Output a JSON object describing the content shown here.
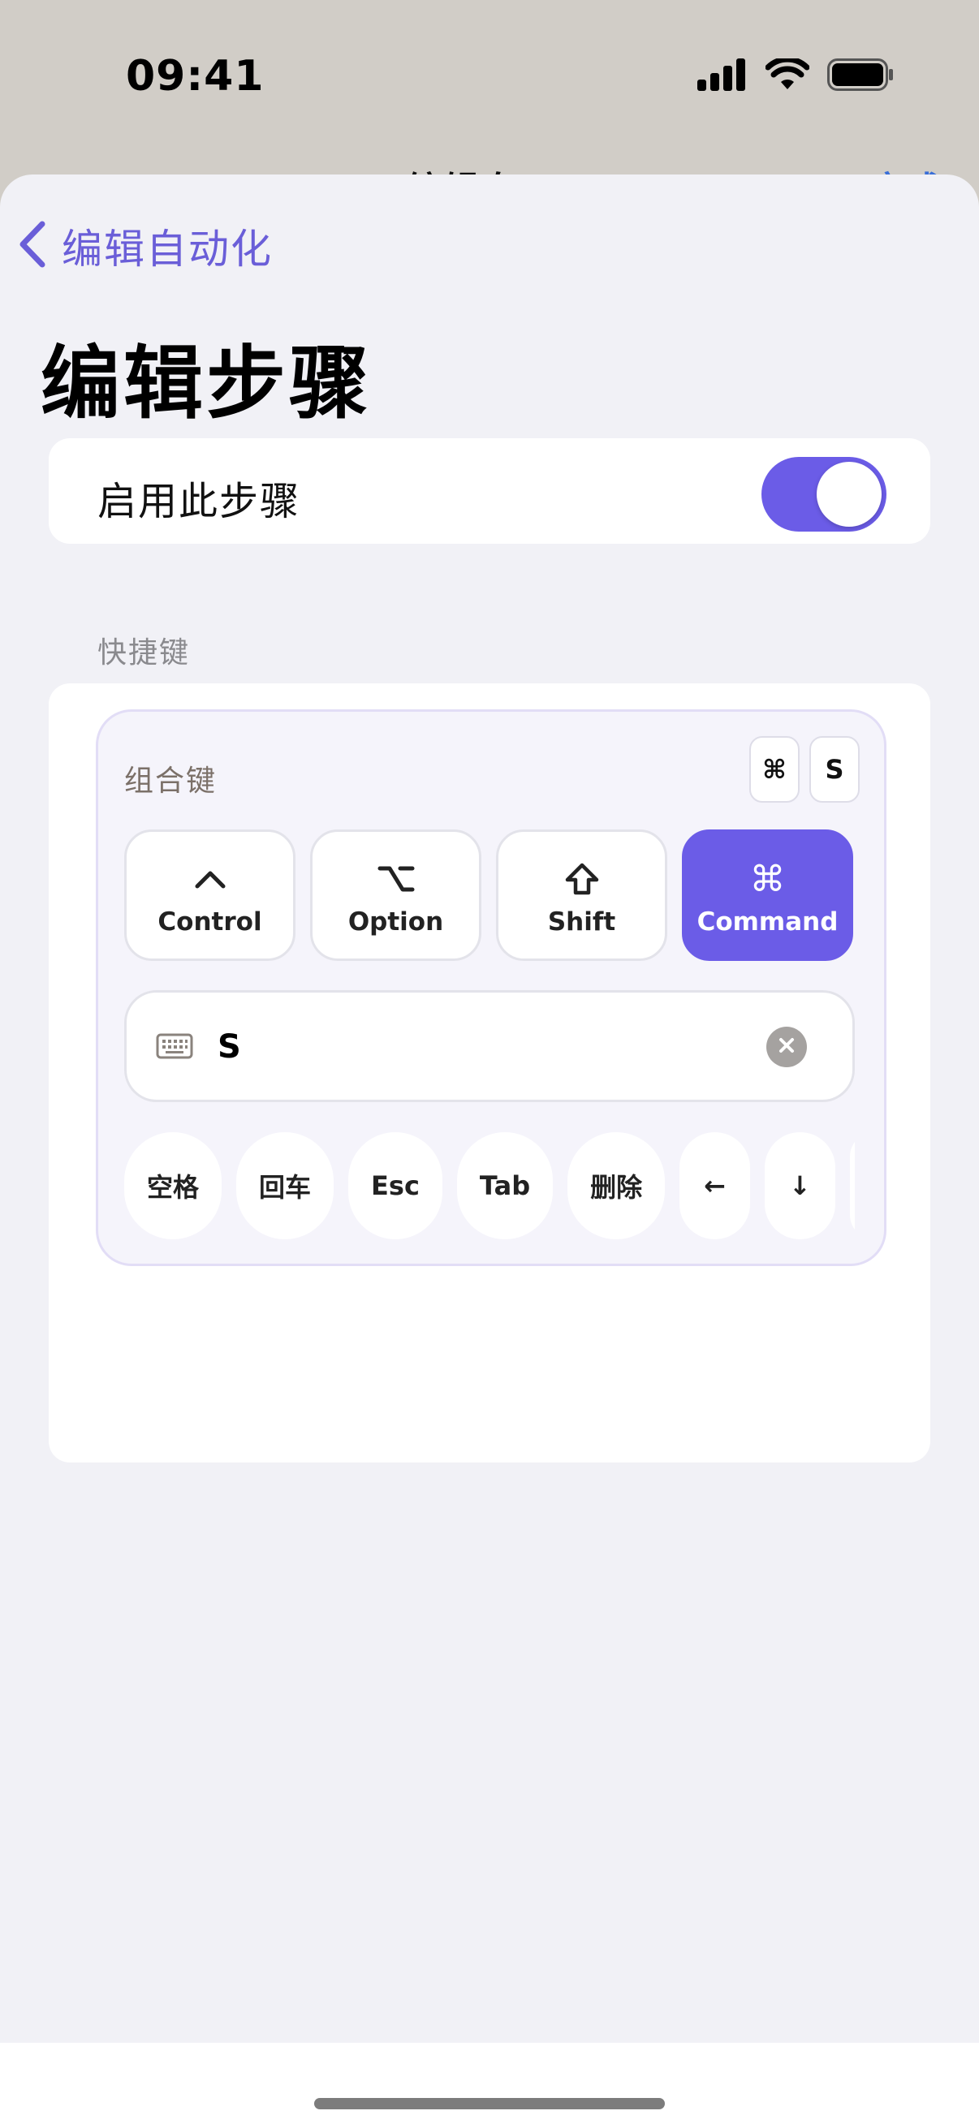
{
  "status_bar": {
    "time": "09:41"
  },
  "background_page": {
    "title_fragment": "编辑自",
    "right_fragment": "完成"
  },
  "nav": {
    "back_label": "编辑自动化"
  },
  "page": {
    "title": "编辑步骤"
  },
  "enable_row": {
    "label": "启用此步骤",
    "enabled": true
  },
  "shortcut_section": {
    "header": "快捷键",
    "combo_label": "组合键",
    "combo_preview": [
      "⌘",
      "S"
    ],
    "modifiers": [
      {
        "symbol": "⌃",
        "label": "Control",
        "active": false
      },
      {
        "symbol": "⌥",
        "label": "Option",
        "active": false
      },
      {
        "symbol": "⇧",
        "label": "Shift",
        "active": false
      },
      {
        "symbol": "⌘",
        "label": "Command",
        "active": true
      }
    ],
    "key_input": {
      "value": "S"
    },
    "quick_keys": [
      "空格",
      "回车",
      "Esc",
      "Tab",
      "删除",
      "←",
      "↓",
      ""
    ]
  },
  "colors": {
    "accent": "#6b5ce7",
    "link": "#6a5ed8",
    "sheet_bg": "#f1f1f6"
  }
}
